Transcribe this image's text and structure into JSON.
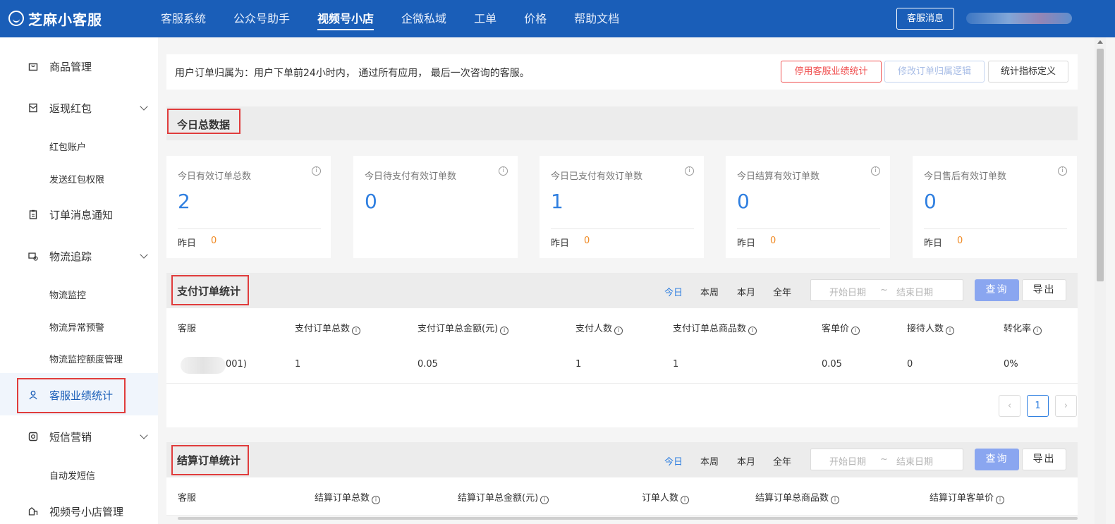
{
  "topbar": {
    "logo_text": "芝麻小客服",
    "nav": [
      "客服系统",
      "公众号助手",
      "视频号小店",
      "企微私域",
      "工单",
      "价格",
      "帮助文档"
    ],
    "active_nav": "视频号小店",
    "msg_button": "客服消息",
    "brand_color": "#1a5eb8"
  },
  "sidebar": {
    "items": [
      {
        "label": "商品管理",
        "icon": "bag-icon"
      },
      {
        "label": "返现红包",
        "icon": "redpacket-icon"
      },
      {
        "label": "红包账户"
      },
      {
        "label": "发送红包权限"
      },
      {
        "label": "订单消息通知",
        "icon": "clipboard-icon"
      },
      {
        "label": "物流追踪",
        "icon": "truck-icon"
      },
      {
        "label": "物流监控"
      },
      {
        "label": "物流异常预警"
      },
      {
        "label": "物流监控额度管理"
      },
      {
        "label": "客服业绩统计",
        "icon": "user-icon"
      },
      {
        "label": "短信营销",
        "icon": "sms-icon"
      },
      {
        "label": "自动发短信"
      },
      {
        "label": "视频号小店管理",
        "icon": "shop-icon"
      }
    ],
    "active": "客服业绩统计"
  },
  "info_bar": {
    "text": "用户订单归属为：用户下单前24小时内， 通过所有应用， 最后一次咨询的客服。",
    "btn_disable": "停用客服业绩统计",
    "btn_modify": "修改订单归属逻辑",
    "btn_define": "统计指标定义"
  },
  "today": {
    "title": "今日总数据",
    "cards": [
      {
        "label": "今日有效订单总数",
        "value": "2",
        "yesterday_label": "昨日",
        "yesterday_value": "0"
      },
      {
        "label": "今日待支付有效订单数",
        "value": "0"
      },
      {
        "label": "今日已支付有效订单数",
        "value": "1",
        "yesterday_label": "昨日",
        "yesterday_value": "0"
      },
      {
        "label": "今日结算有效订单数",
        "value": "0",
        "yesterday_label": "昨日",
        "yesterday_value": "0"
      },
      {
        "label": "今日售后有效订单数",
        "value": "0",
        "yesterday_label": "昨日",
        "yesterday_value": "0"
      }
    ]
  },
  "pay_section": {
    "title": "支付订单统计",
    "tabs": [
      "今日",
      "本周",
      "本月",
      "全年"
    ],
    "active_tab": "今日",
    "start_placeholder": "开始日期",
    "tilde": "~",
    "end_placeholder": "结束日期",
    "query": "查询",
    "export": "导出",
    "columns": [
      "客服",
      "支付订单总数",
      "支付订单总金额(元)",
      "支付人数",
      "支付订单总商品数",
      "客单价",
      "接待人数",
      "转化率"
    ],
    "rows": [
      [
        "001)",
        "1",
        "0.05",
        "1",
        "1",
        "0.05",
        "0",
        "0%"
      ]
    ],
    "page": "1"
  },
  "settle_section": {
    "title": "结算订单统计",
    "tabs": [
      "今日",
      "本周",
      "本月",
      "全年"
    ],
    "active_tab": "今日",
    "start_placeholder": "开始日期",
    "tilde": "~",
    "end_placeholder": "结束日期",
    "query": "查询",
    "export": "导出",
    "columns": [
      "客服",
      "结算订单总数",
      "结算订单总金额(元)",
      "订单人数",
      "结算订单总商品数",
      "结算订单客单价"
    ]
  }
}
